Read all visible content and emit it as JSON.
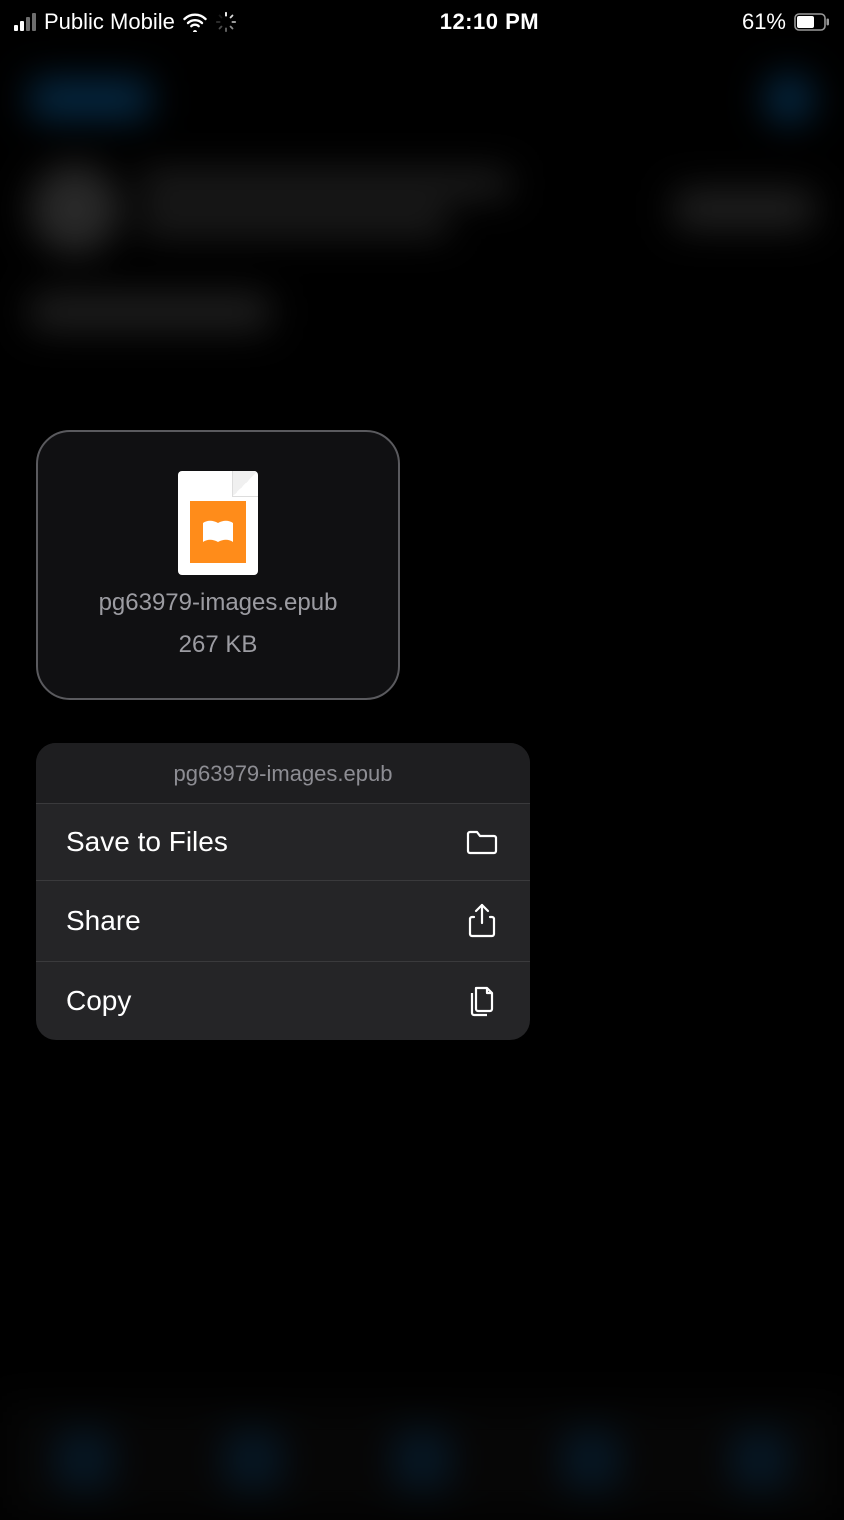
{
  "status": {
    "carrier": "Public Mobile",
    "time": "12:10 PM",
    "battery_pct": "61%"
  },
  "file": {
    "name": "pg63979-images.epub",
    "size": "267 KB"
  },
  "menu": {
    "header": "pg63979-images.epub",
    "save_label": "Save to Files",
    "share_label": "Share",
    "copy_label": "Copy"
  }
}
